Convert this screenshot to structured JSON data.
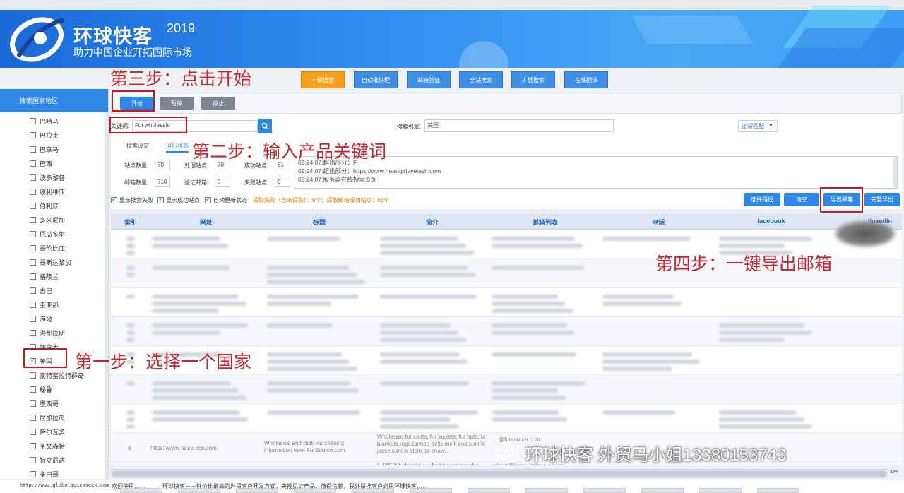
{
  "banner": {
    "title": "环球快客",
    "year": "2019",
    "tagline": "助力中国企业开拓国际市场"
  },
  "top_nav": [
    {
      "label": "一键搜索",
      "active": true
    },
    {
      "label": "自动批处理"
    },
    {
      "label": "邮箱验证"
    },
    {
      "label": "全站搜索"
    },
    {
      "label": "扩展搜索"
    },
    {
      "label": "在线翻译"
    }
  ],
  "sidebar": {
    "header": "搜索国家地区",
    "countries": [
      {
        "name": "巴哈马",
        "checked": false
      },
      {
        "name": "巴拉圭",
        "checked": false
      },
      {
        "name": "巴拿马",
        "checked": false
      },
      {
        "name": "巴西",
        "checked": false
      },
      {
        "name": "波多黎各",
        "checked": false
      },
      {
        "name": "玻利维亚",
        "checked": false
      },
      {
        "name": "伯利兹",
        "checked": false
      },
      {
        "name": "多米尼加",
        "checked": false
      },
      {
        "name": "厄瓜多尔",
        "checked": false
      },
      {
        "name": "哥伦比亚",
        "checked": false
      },
      {
        "name": "哥斯达黎加",
        "checked": false
      },
      {
        "name": "格陵兰",
        "checked": false
      },
      {
        "name": "古巴",
        "checked": false
      },
      {
        "name": "圭亚那",
        "checked": false
      },
      {
        "name": "海地",
        "checked": false
      },
      {
        "name": "洪都拉斯",
        "checked": false
      },
      {
        "name": "加拿大",
        "checked": false
      },
      {
        "name": "美国",
        "checked": true
      },
      {
        "name": "蒙特塞拉特群岛",
        "checked": false
      },
      {
        "name": "秘鲁",
        "checked": false
      },
      {
        "name": "墨西哥",
        "checked": false
      },
      {
        "name": "尼加拉瓜",
        "checked": false
      },
      {
        "name": "萨尔瓦多",
        "checked": false
      },
      {
        "name": "圣文森特",
        "checked": false
      },
      {
        "name": "特立尼达",
        "checked": false
      },
      {
        "name": "多巴哥",
        "checked": false
      }
    ]
  },
  "toolbar": {
    "start": "开始",
    "pause": "暂停",
    "stop": "停止"
  },
  "search": {
    "keyword_label": "关键词:",
    "keyword_value": "Fur wholesale",
    "engine_label": "搜索引擎:",
    "engine_value": "美国",
    "match_mode": "正常匹配"
  },
  "tabs": {
    "settings": "搜索设定",
    "status": "运行状态"
  },
  "stats_fields": {
    "site_count": {
      "label": "站点数量:",
      "value": "70"
    },
    "processed_sites": {
      "label": "处理站点:",
      "value": "70"
    },
    "success_sites": {
      "label": "成功站点:",
      "value": "61"
    },
    "email_count": {
      "label": "邮箱数量:",
      "value": "710"
    },
    "verified_emails": {
      "label": "验证邮箱:",
      "value": "0"
    },
    "failed_sites": {
      "label": "失败站点:",
      "value": "9"
    }
  },
  "log_lines": [
    "09:24:07:超出部分：F",
    "09:24:07:超出部分：https://www.heartgirleyelash.com",
    "09:24:07:服务器在线搜索:0页"
  ],
  "checks": {
    "show_failed": "显示搜索失败",
    "show_success": "显示成功站点",
    "auto_update": "自动更新状态"
  },
  "summary": "提取失败（含未提取）：9个；提取邮箱成功站点：61个！",
  "actions": {
    "select_path": "选择路径",
    "clear": "清空",
    "export_email": "导出邮箱",
    "export_full": "完整导出"
  },
  "table": {
    "headers": [
      "索引",
      "网址",
      "标题",
      "简介",
      "邮箱列表",
      "电话",
      "facebook",
      "linkedin"
    ],
    "row_8": {
      "index": "8",
      "url": "https://www.fursource.com",
      "title": "Wholesale and Bulk Purchasing information from FurSource.com",
      "intro": "Wholesale fur coats, fur jackets, fur hats,fur blankets,rugs,tanned pelts,mink coats,mink jackets,mink stole,fur shaw...",
      "email": "....@fursource.com"
    },
    "row_9": {
      "intro": "LUXE Wholesale is a fashion wholesaler ...",
      "email": "admin@luxe-wholesale.com"
    }
  },
  "scroll_pct": "0%",
  "status": {
    "url": "http://www.globalquickseek.com",
    "welcome": "欢迎使用……",
    "message": "环球快客－－性价比最高的外贸客户开发方式，央视见证产品，值得信赖，我外贸搜客户必用环球快客……"
  },
  "annotations": {
    "step1": "第一步：选择一个国家",
    "step2": "第二步：输入产品关键词",
    "step3": "第三步：点击开始",
    "step4": "第四步：一键导出邮箱"
  },
  "watermark": "环球快客 外贸马小姐13380153743",
  "colors": {
    "accent_blue": "#2f86e4",
    "nav_orange": "#f7a11b",
    "annotation_red": "#c1272d",
    "stats_orange": "#e07b00"
  }
}
